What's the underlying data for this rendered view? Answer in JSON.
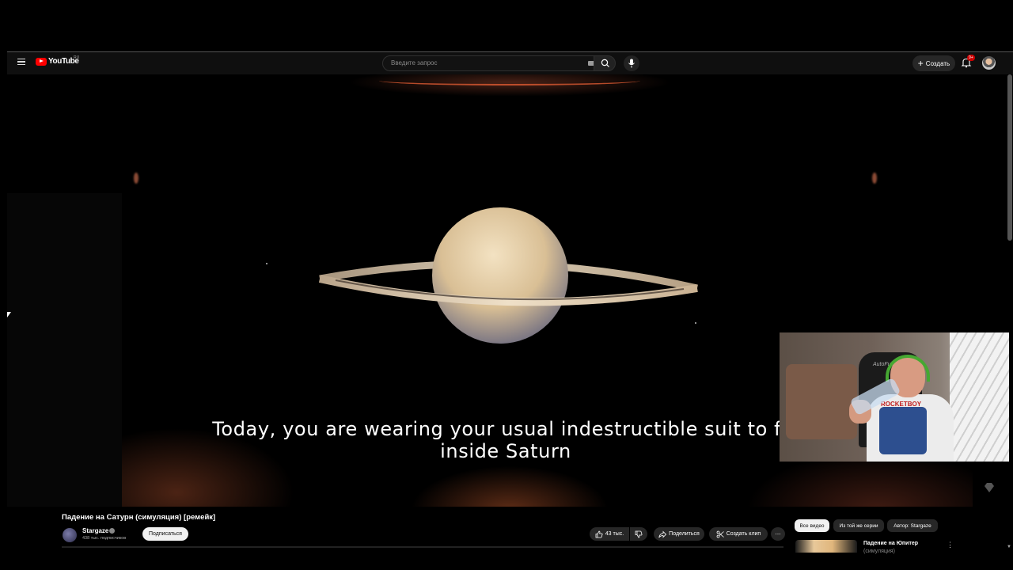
{
  "masthead": {
    "logo_text": "YouTube",
    "country_code": "RU",
    "search_placeholder": "Введите запрос",
    "create_label": "Создать",
    "notification_badge": "9+"
  },
  "video": {
    "subtitle_line1": "Today, you are wearing your usual indestructible suit to fal",
    "subtitle_line2": "inside Saturn"
  },
  "webcam": {
    "chair_brand": "AutoFull",
    "shirt_text": "ROCKETBOY"
  },
  "info": {
    "title": "Падение на Сатурн (симуляция) [ремейк]",
    "channel_name": "Stargaze",
    "subscribers": "438 тыс. подписчиков",
    "subscribe_label": "Подписаться",
    "likes": "43 тыс.",
    "share_label": "Поделиться",
    "clip_label": "Создать клип"
  },
  "chips": [
    "Все видео",
    "Из той же серии",
    "Автор: Stargaze"
  ],
  "recommendation": {
    "title": "Падение на Юпитер",
    "title_cont": "(симуляция)"
  },
  "colors": {
    "brand_red": "#ff0000",
    "masthead_bg": "#0f0f0f",
    "pill_bg": "#272727"
  }
}
